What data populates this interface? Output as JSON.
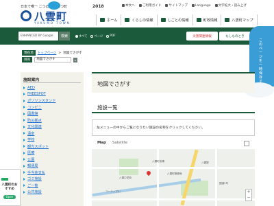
{
  "header": {
    "tagline": "日本で唯一 二つの海 をもつ町",
    "logo_text": "八雲町",
    "logo_sub": "YAKUMO TOWN",
    "year": "2018",
    "utility": [
      "本文へ",
      "ご利用ガイド",
      "サイトマップ",
      "Language",
      "文字拡大・読み上げ"
    ],
    "nav": [
      {
        "label": "ホーム",
        "icon": "home-icon"
      },
      {
        "label": "くらしの情報",
        "icon": "life-icon"
      },
      {
        "label": "しごとの情報",
        "icon": "work-icon"
      },
      {
        "label": "町政情報",
        "icon": "gov-icon"
      },
      {
        "label": "八雲町マップ",
        "icon": "map-icon"
      }
    ]
  },
  "search": {
    "brand": "ENHANCED BY Google",
    "button": "検索",
    "options": [
      "すべて",
      "ページ",
      "PDF"
    ],
    "btn_red": "災害関連情報",
    "btn_green": "もしものとき"
  },
  "side_tab": "このページを一時保存する",
  "breadcrumb": {
    "label": "現在地",
    "link": "トップページ",
    "sep": ">",
    "current": "地図でさがす",
    "label2": "目的",
    "select_value": "地図でさがす"
  },
  "sidebar": {
    "title": "施設案内",
    "items": [
      "AED",
      "FREESPOT",
      "ガソリンスタンド",
      "コンビニ",
      "図書館",
      "防災拠点",
      "文化関連",
      "温泉",
      "学校",
      "観光スポット",
      "医療",
      "公園",
      "郵便局",
      "手当金支払",
      "ゴミ施設",
      "ご一覧",
      "公共施設"
    ]
  },
  "recommend": {
    "title": "八雲町のおすすめ",
    "badge": "Open"
  },
  "main": {
    "title": "地図でさがす",
    "subtitle": "施設一覧",
    "instruction": "左メニューの中からご覧になりたい施設の名称をクリックしてください。"
  },
  "map": {
    "tab_map": "Map",
    "tab_satellite": "Satellite",
    "labels": [
      "八雲町役場",
      "八雲中学校",
      "八雲駅",
      "八雲町郵便局",
      "国道5号",
      "ユーラップ川"
    ]
  },
  "colors": {
    "primary": "#1b5a3b",
    "accent": "#3a9dd6",
    "link": "#1a6dd0"
  }
}
